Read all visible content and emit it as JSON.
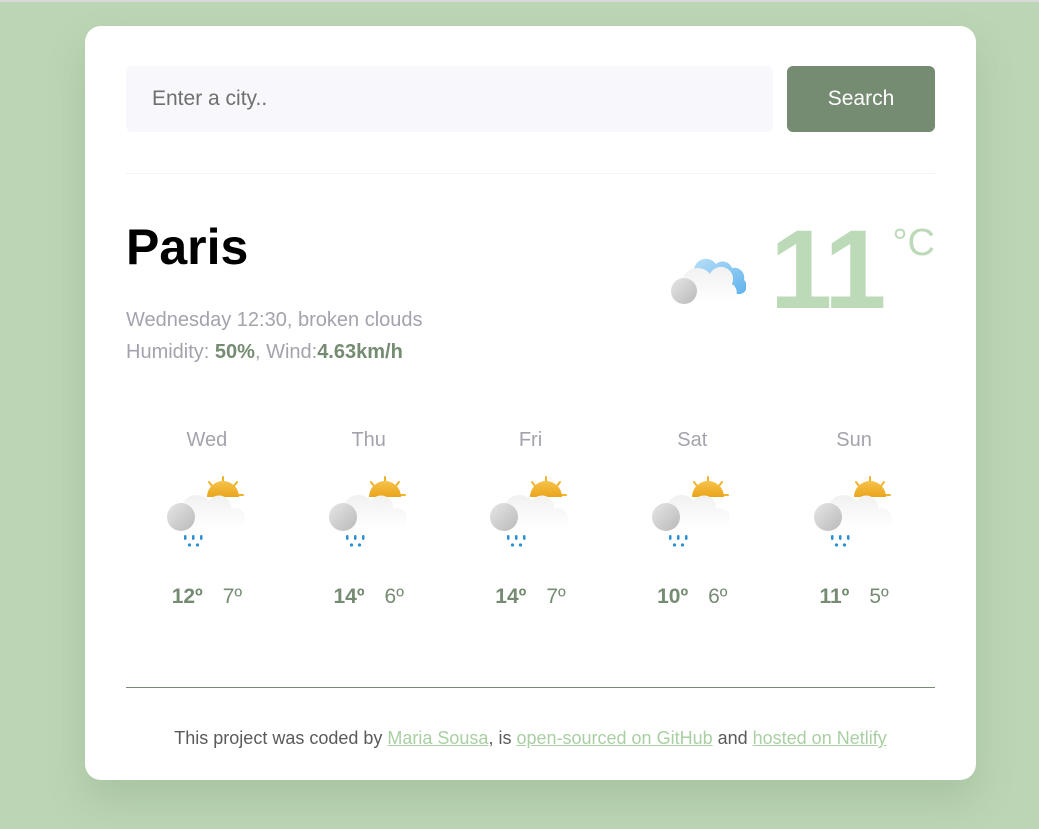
{
  "search": {
    "placeholder": "Enter a city..",
    "value": "",
    "button_label": "Search"
  },
  "current": {
    "city": "Paris",
    "day_time": "Wednesday 12:30",
    "description": "broken clouds",
    "humidity_label": "Humidity: ",
    "humidity_value": "50%",
    "wind_label": "Wind:",
    "wind_value": "4.63km/h",
    "temperature": "11",
    "unit": "°C",
    "icon": "broken-clouds-icon"
  },
  "forecast": [
    {
      "day": "Wed",
      "icon": "rain-sun-icon",
      "max": "12º",
      "min": "7º"
    },
    {
      "day": "Thu",
      "icon": "rain-sun-icon",
      "max": "14º",
      "min": "6º"
    },
    {
      "day": "Fri",
      "icon": "rain-sun-icon",
      "max": "14º",
      "min": "7º"
    },
    {
      "day": "Sat",
      "icon": "rain-sun-icon",
      "max": "10º",
      "min": "6º"
    },
    {
      "day": "Sun",
      "icon": "rain-sun-icon",
      "max": "11º",
      "min": "5º"
    }
  ],
  "footer": {
    "prefix": "This project was coded by ",
    "author_link": "Maria Sousa",
    "middle": ", is ",
    "github_link": "open-sourced on GitHub",
    "and": " and ",
    "netlify_link": "hosted on Netlify"
  },
  "colors": {
    "background": "#bcd6b5",
    "accent": "#758c72",
    "temperature": "#bcdab8",
    "link": "#a9cfa3",
    "muted_text": "#a3a3ae"
  }
}
